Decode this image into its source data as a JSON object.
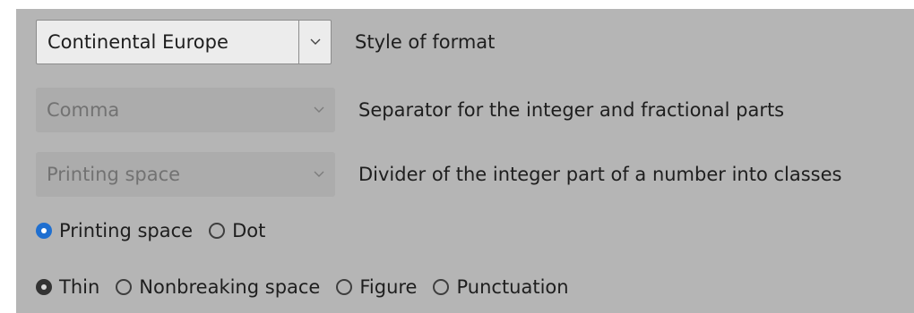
{
  "format_style": {
    "value": "Continental Europe",
    "description": "Style of format"
  },
  "decimal_separator": {
    "value": "Comma",
    "description": "Separator for the integer and fractional parts"
  },
  "group_divider": {
    "value": "Printing space",
    "description": "Divider of the integer part of a number into classes"
  },
  "divider_type": {
    "options": [
      {
        "label": "Printing space",
        "selected": true
      },
      {
        "label": "Dot",
        "selected": false
      }
    ]
  },
  "space_type": {
    "options": [
      {
        "label": "Thin",
        "selected": true
      },
      {
        "label": "Nonbreaking space",
        "selected": false
      },
      {
        "label": "Figure",
        "selected": false
      },
      {
        "label": "Punctuation",
        "selected": false
      }
    ]
  },
  "colors": {
    "panel_background": "#b5b5b5",
    "accent_selected": "#1f6fd0",
    "disabled_text": "#727272"
  },
  "icons": {
    "dropdown": "chevron-down-icon"
  }
}
